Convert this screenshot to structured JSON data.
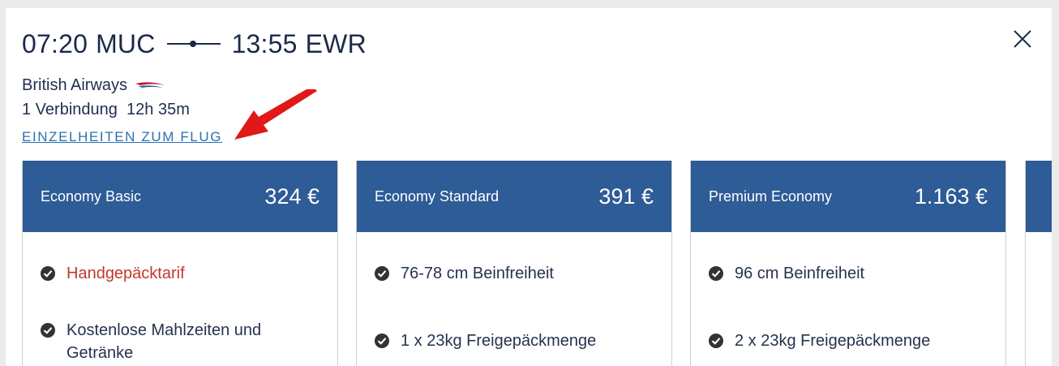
{
  "flight": {
    "departure_time": "07:20",
    "departure_airport": "MUC",
    "arrival_time": "13:55",
    "arrival_airport": "EWR",
    "airline": "British Airways",
    "connections": "1 Verbindung",
    "duration": "12h 35m",
    "details_link": "EINZELHEITEN ZUM FLUG"
  },
  "icons": {
    "close": "close-icon",
    "check": "check-circle-icon",
    "airline_logo": "british-airways-logo",
    "annotation": "red-arrow-icon"
  },
  "colors": {
    "header": "#2d5c96",
    "link": "#2b6fb3",
    "highlight_text": "#c0392b",
    "annotation_arrow": "#e01818"
  },
  "fares": [
    {
      "name": "Economy Basic",
      "price": "324 €",
      "features": [
        "Handgepäcktarif",
        "Kostenlose Mahlzeiten und Getränke"
      ]
    },
    {
      "name": "Economy Standard",
      "price": "391 €",
      "features": [
        "76-78 cm Beinfreiheit",
        "1 x 23kg Freigepäckmenge"
      ]
    },
    {
      "name": "Premium Economy",
      "price": "1.163 €",
      "features": [
        "96 cm Beinfreiheit",
        "2 x 23kg Freigepäckmenge"
      ]
    }
  ]
}
